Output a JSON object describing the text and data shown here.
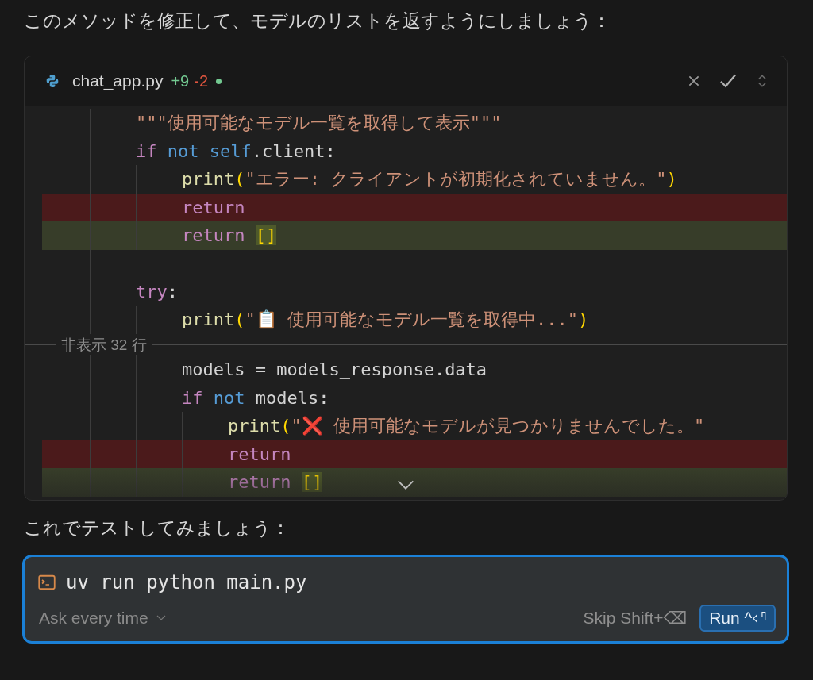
{
  "intro": "このメソッドを修正して、モデルのリストを返すようにしましょう：",
  "diff": {
    "file": "chat_app.py",
    "added": "+9",
    "removed": "-2",
    "modified": true,
    "lines": [
      {
        "kind": "normal",
        "tokens": [
          {
            "kind": "string",
            "text": "\"\"\"使用可能なモデル一覧を取得して表示\"\"\""
          }
        ]
      },
      {
        "kind": "normal",
        "tokens": [
          {
            "kind": "keyword",
            "text": "if "
          },
          {
            "kind": "operator",
            "text": "not "
          },
          {
            "kind": "variable",
            "text": "self"
          },
          {
            "kind": "plain",
            "text": ".client:"
          }
        ],
        "children": [
          {
            "kind": "normal",
            "tokens": [
              {
                "kind": "function",
                "text": "print"
              },
              {
                "kind": "paren",
                "text": "("
              },
              {
                "kind": "string",
                "text": "\"エラー: クライアントが初期化されていません。\""
              },
              {
                "kind": "paren",
                "text": ")"
              }
            ]
          },
          {
            "kind": "removed",
            "tokens": [
              {
                "kind": "keyword",
                "text": "return"
              }
            ]
          },
          {
            "kind": "added",
            "tokens": [
              {
                "kind": "keyword",
                "text": "return "
              },
              {
                "kind": "paren",
                "text": "[]",
                "changed": true
              }
            ]
          }
        ]
      },
      {
        "kind": "blank"
      },
      {
        "kind": "normal",
        "tokens": [
          {
            "kind": "keyword",
            "text": "try"
          },
          {
            "kind": "plain",
            "text": ":"
          }
        ],
        "children": [
          {
            "kind": "normal",
            "tokens": [
              {
                "kind": "function",
                "text": "print"
              },
              {
                "kind": "paren",
                "text": "("
              },
              {
                "kind": "string",
                "text": "\"📋 使用可能なモデル一覧を取得中...\""
              },
              {
                "kind": "paren",
                "text": ")"
              }
            ]
          },
          {
            "kind": "fold",
            "label": "非表示 32 行"
          },
          {
            "kind": "normal",
            "tokens": [
              {
                "kind": "plain",
                "text": "models = models_response.data"
              }
            ]
          },
          {
            "kind": "normal",
            "tokens": [
              {
                "kind": "keyword",
                "text": "if "
              },
              {
                "kind": "operator",
                "text": "not "
              },
              {
                "kind": "plain",
                "text": "models:"
              }
            ],
            "children": [
              {
                "kind": "normal",
                "tokens": [
                  {
                    "kind": "function",
                    "text": "print"
                  },
                  {
                    "kind": "paren",
                    "text": "("
                  },
                  {
                    "kind": "string",
                    "text": "\"❌ 使用可能なモデルが見つかりませんでした。\""
                  }
                ]
              },
              {
                "kind": "removed",
                "tokens": [
                  {
                    "kind": "keyword",
                    "text": "return"
                  }
                ]
              },
              {
                "kind": "added",
                "tokens": [
                  {
                    "kind": "keyword",
                    "text": "return "
                  },
                  {
                    "kind": "paren",
                    "text": "[]",
                    "changed": true
                  }
                ]
              }
            ]
          }
        ]
      }
    ]
  },
  "outro": "これでテストしてみましょう：",
  "terminal": {
    "command": "uv run python main.py",
    "mode": "Ask every time",
    "skip": "Skip Shift+⌫",
    "run": "Run ^⏎"
  }
}
